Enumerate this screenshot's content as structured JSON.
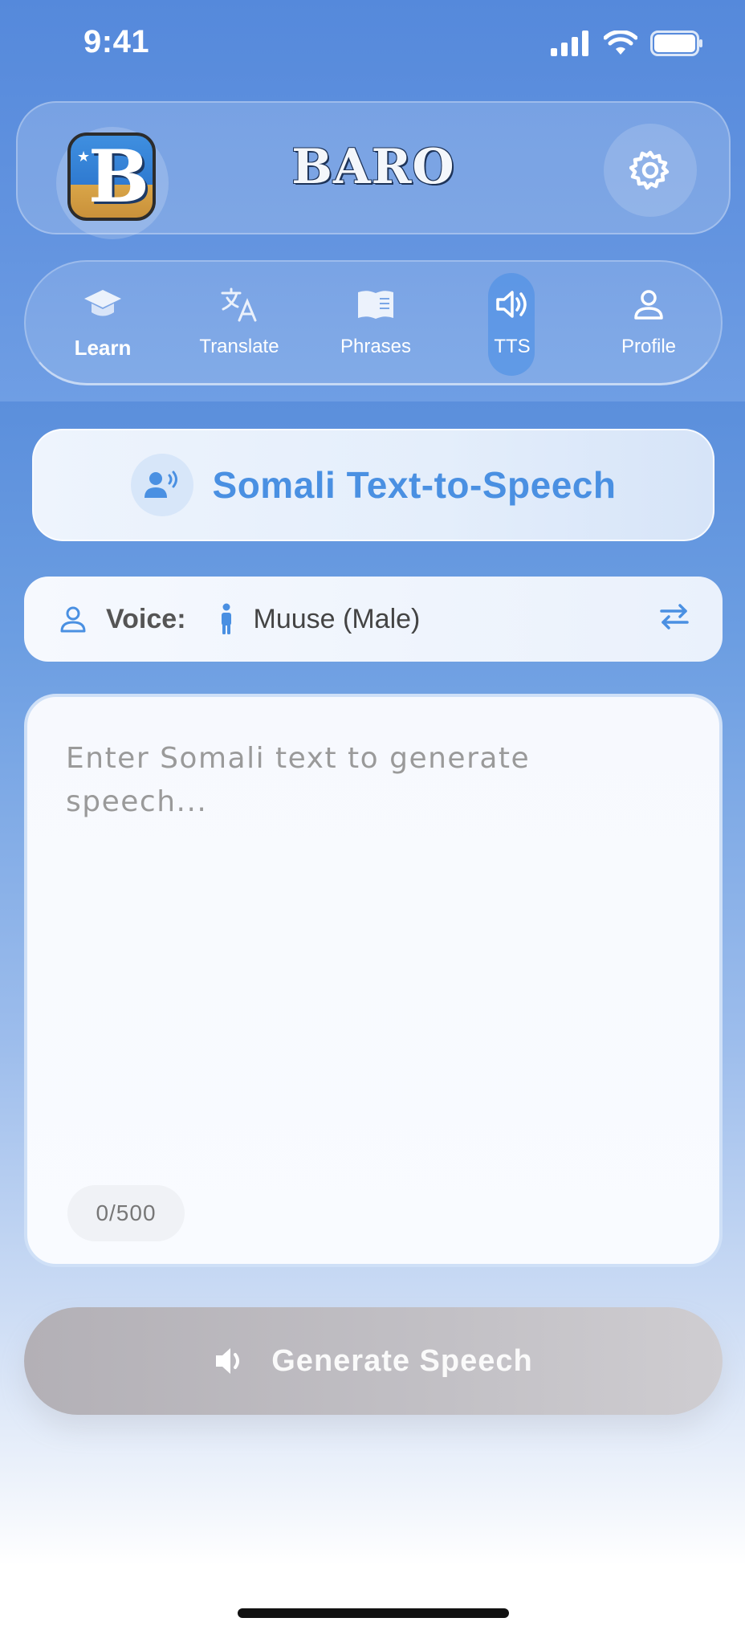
{
  "status_bar": {
    "time": "9:41"
  },
  "header": {
    "brand": "BARO",
    "logo_letter": "B"
  },
  "nav": {
    "items": [
      {
        "label": "Learn",
        "icon": "graduation-cap-icon"
      },
      {
        "label": "Translate",
        "icon": "translate-icon"
      },
      {
        "label": "Phrases",
        "icon": "book-icon"
      },
      {
        "label": "TTS",
        "icon": "speaker-icon"
      },
      {
        "label": "Profile",
        "icon": "person-icon"
      }
    ],
    "active": "TTS"
  },
  "title_card": {
    "title": "Somali Text-to-Speech"
  },
  "voice": {
    "label": "Voice:",
    "value": "Muuse (Male)"
  },
  "text_area": {
    "placeholder": "Enter Somali text to generate speech...",
    "value": "",
    "counter": "0/500"
  },
  "generate_button": {
    "label": "Generate Speech"
  },
  "colors": {
    "accent": "#4a90e2",
    "background_top": "#5a8fdd",
    "button_disabled": "#bdbbc0"
  }
}
